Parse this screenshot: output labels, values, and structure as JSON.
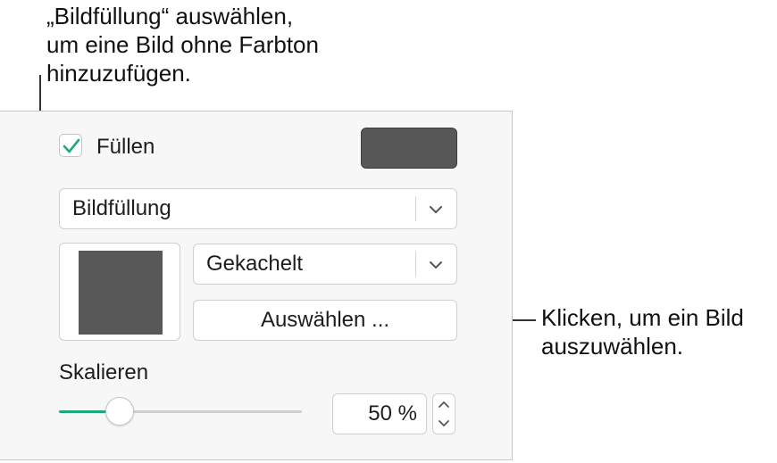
{
  "callouts": {
    "top_lines": [
      "„Bildfüllung“ auswählen,",
      "um eine Bild ohne Farbton",
      "hinzuzufügen."
    ],
    "right_lines": [
      "Klicken, um ein Bild",
      "auszuwählen."
    ]
  },
  "fill": {
    "checked": true,
    "label": "Füllen",
    "color": "#575757"
  },
  "fill_type_select": {
    "value": "Bildfüllung"
  },
  "image": {
    "preview_color": "#585858",
    "tiling_select": {
      "value": "Gekachelt"
    },
    "choose_label": "Auswählen ..."
  },
  "scale": {
    "label": "Skalieren",
    "value": 0.25,
    "display": "50 %"
  },
  "colors": {
    "accent": "#1fa97a"
  }
}
